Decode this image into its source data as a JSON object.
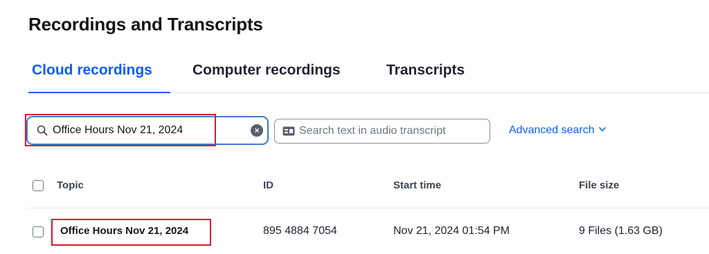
{
  "page": {
    "title": "Recordings and Transcripts"
  },
  "tabs": [
    {
      "label": "Cloud recordings",
      "active": true
    },
    {
      "label": "Computer recordings",
      "active": false
    },
    {
      "label": "Transcripts",
      "active": false
    }
  ],
  "search": {
    "value": "Office Hours Nov 21, 2024",
    "clear_icon": "clear-icon"
  },
  "transcript_search": {
    "placeholder": "Search text in audio transcript"
  },
  "advanced_search": {
    "label": "Advanced search"
  },
  "table": {
    "headers": {
      "topic": "Topic",
      "id": "ID",
      "start_time": "Start time",
      "file_size": "File size"
    },
    "rows": [
      {
        "topic": "Office Hours Nov 21, 2024",
        "id": "895 4884 7054",
        "start_time": "Nov 21, 2024 01:54 PM",
        "file_size": "9 Files (1.63 GB)"
      }
    ]
  },
  "colors": {
    "accent": "#0b5cff",
    "highlight": "#e0162b"
  }
}
